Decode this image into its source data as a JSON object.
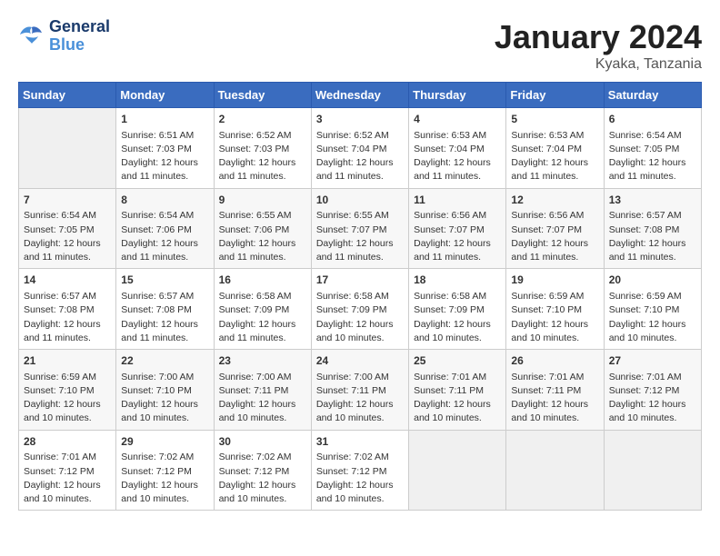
{
  "header": {
    "logo_line1": "General",
    "logo_line2": "Blue",
    "month_year": "January 2024",
    "location": "Kyaka, Tanzania"
  },
  "days_of_week": [
    "Sunday",
    "Monday",
    "Tuesday",
    "Wednesday",
    "Thursday",
    "Friday",
    "Saturday"
  ],
  "weeks": [
    [
      {
        "day": "",
        "info": ""
      },
      {
        "day": "1",
        "info": "Sunrise: 6:51 AM\nSunset: 7:03 PM\nDaylight: 12 hours\nand 11 minutes."
      },
      {
        "day": "2",
        "info": "Sunrise: 6:52 AM\nSunset: 7:03 PM\nDaylight: 12 hours\nand 11 minutes."
      },
      {
        "day": "3",
        "info": "Sunrise: 6:52 AM\nSunset: 7:04 PM\nDaylight: 12 hours\nand 11 minutes."
      },
      {
        "day": "4",
        "info": "Sunrise: 6:53 AM\nSunset: 7:04 PM\nDaylight: 12 hours\nand 11 minutes."
      },
      {
        "day": "5",
        "info": "Sunrise: 6:53 AM\nSunset: 7:04 PM\nDaylight: 12 hours\nand 11 minutes."
      },
      {
        "day": "6",
        "info": "Sunrise: 6:54 AM\nSunset: 7:05 PM\nDaylight: 12 hours\nand 11 minutes."
      }
    ],
    [
      {
        "day": "7",
        "info": "Sunrise: 6:54 AM\nSunset: 7:05 PM\nDaylight: 12 hours\nand 11 minutes."
      },
      {
        "day": "8",
        "info": "Sunrise: 6:54 AM\nSunset: 7:06 PM\nDaylight: 12 hours\nand 11 minutes."
      },
      {
        "day": "9",
        "info": "Sunrise: 6:55 AM\nSunset: 7:06 PM\nDaylight: 12 hours\nand 11 minutes."
      },
      {
        "day": "10",
        "info": "Sunrise: 6:55 AM\nSunset: 7:07 PM\nDaylight: 12 hours\nand 11 minutes."
      },
      {
        "day": "11",
        "info": "Sunrise: 6:56 AM\nSunset: 7:07 PM\nDaylight: 12 hours\nand 11 minutes."
      },
      {
        "day": "12",
        "info": "Sunrise: 6:56 AM\nSunset: 7:07 PM\nDaylight: 12 hours\nand 11 minutes."
      },
      {
        "day": "13",
        "info": "Sunrise: 6:57 AM\nSunset: 7:08 PM\nDaylight: 12 hours\nand 11 minutes."
      }
    ],
    [
      {
        "day": "14",
        "info": "Sunrise: 6:57 AM\nSunset: 7:08 PM\nDaylight: 12 hours\nand 11 minutes."
      },
      {
        "day": "15",
        "info": "Sunrise: 6:57 AM\nSunset: 7:08 PM\nDaylight: 12 hours\nand 11 minutes."
      },
      {
        "day": "16",
        "info": "Sunrise: 6:58 AM\nSunset: 7:09 PM\nDaylight: 12 hours\nand 11 minutes."
      },
      {
        "day": "17",
        "info": "Sunrise: 6:58 AM\nSunset: 7:09 PM\nDaylight: 12 hours\nand 10 minutes."
      },
      {
        "day": "18",
        "info": "Sunrise: 6:58 AM\nSunset: 7:09 PM\nDaylight: 12 hours\nand 10 minutes."
      },
      {
        "day": "19",
        "info": "Sunrise: 6:59 AM\nSunset: 7:10 PM\nDaylight: 12 hours\nand 10 minutes."
      },
      {
        "day": "20",
        "info": "Sunrise: 6:59 AM\nSunset: 7:10 PM\nDaylight: 12 hours\nand 10 minutes."
      }
    ],
    [
      {
        "day": "21",
        "info": "Sunrise: 6:59 AM\nSunset: 7:10 PM\nDaylight: 12 hours\nand 10 minutes."
      },
      {
        "day": "22",
        "info": "Sunrise: 7:00 AM\nSunset: 7:10 PM\nDaylight: 12 hours\nand 10 minutes."
      },
      {
        "day": "23",
        "info": "Sunrise: 7:00 AM\nSunset: 7:11 PM\nDaylight: 12 hours\nand 10 minutes."
      },
      {
        "day": "24",
        "info": "Sunrise: 7:00 AM\nSunset: 7:11 PM\nDaylight: 12 hours\nand 10 minutes."
      },
      {
        "day": "25",
        "info": "Sunrise: 7:01 AM\nSunset: 7:11 PM\nDaylight: 12 hours\nand 10 minutes."
      },
      {
        "day": "26",
        "info": "Sunrise: 7:01 AM\nSunset: 7:11 PM\nDaylight: 12 hours\nand 10 minutes."
      },
      {
        "day": "27",
        "info": "Sunrise: 7:01 AM\nSunset: 7:12 PM\nDaylight: 12 hours\nand 10 minutes."
      }
    ],
    [
      {
        "day": "28",
        "info": "Sunrise: 7:01 AM\nSunset: 7:12 PM\nDaylight: 12 hours\nand 10 minutes."
      },
      {
        "day": "29",
        "info": "Sunrise: 7:02 AM\nSunset: 7:12 PM\nDaylight: 12 hours\nand 10 minutes."
      },
      {
        "day": "30",
        "info": "Sunrise: 7:02 AM\nSunset: 7:12 PM\nDaylight: 12 hours\nand 10 minutes."
      },
      {
        "day": "31",
        "info": "Sunrise: 7:02 AM\nSunset: 7:12 PM\nDaylight: 12 hours\nand 10 minutes."
      },
      {
        "day": "",
        "info": ""
      },
      {
        "day": "",
        "info": ""
      },
      {
        "day": "",
        "info": ""
      }
    ]
  ]
}
